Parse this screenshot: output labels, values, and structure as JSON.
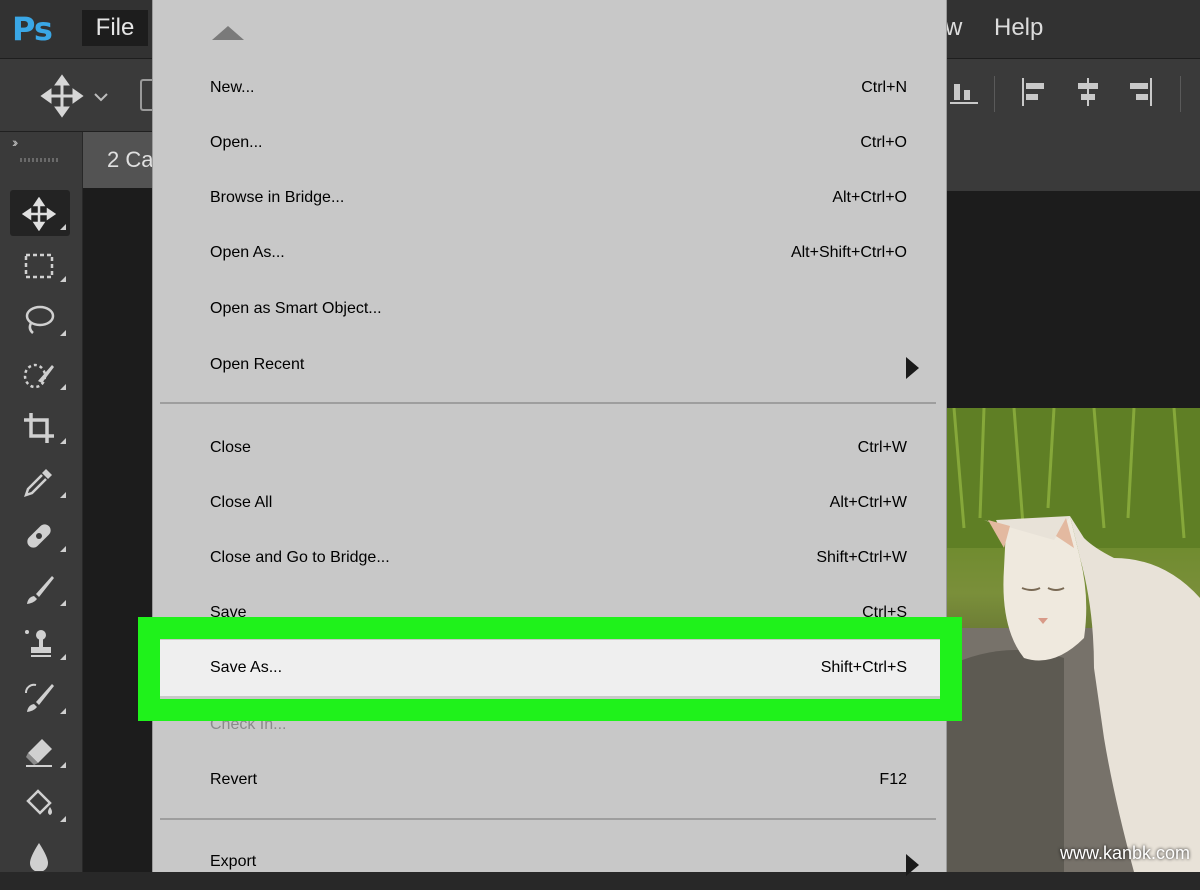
{
  "app": {
    "logo": "Ps",
    "menubar": {
      "file": "File",
      "partial": "w",
      "help": "Help"
    },
    "document_tab": "2 Ca",
    "watermark": "www.kanbk.com"
  },
  "file_menu": {
    "group1": [
      {
        "label": "New...",
        "shortcut": "Ctrl+N"
      },
      {
        "label": "Open...",
        "shortcut": "Ctrl+O"
      },
      {
        "label": "Browse in Bridge...",
        "shortcut": "Alt+Ctrl+O"
      },
      {
        "label": "Open As...",
        "shortcut": "Alt+Shift+Ctrl+O"
      },
      {
        "label": "Open as Smart Object...",
        "shortcut": ""
      },
      {
        "label": "Open Recent",
        "shortcut": "",
        "submenu": true
      }
    ],
    "group2": [
      {
        "label": "Close",
        "shortcut": "Ctrl+W"
      },
      {
        "label": "Close All",
        "shortcut": "Alt+Ctrl+W"
      },
      {
        "label": "Close and Go to Bridge...",
        "shortcut": "Shift+Ctrl+W"
      },
      {
        "label": "Save",
        "shortcut": "Ctrl+S"
      },
      {
        "label": "Save As...",
        "shortcut": "Shift+Ctrl+S",
        "highlighted": true
      },
      {
        "label": "Check In...",
        "shortcut": "",
        "disabled": true
      },
      {
        "label": "Revert",
        "shortcut": "F12"
      }
    ],
    "group3": [
      {
        "label": "Export",
        "shortcut": "",
        "submenu": true
      }
    ]
  },
  "colors": {
    "highlight_outline": "#1ff21b",
    "menu_bg": "#c8c8c8",
    "ps_blue": "#3aa7e6"
  },
  "toolbar_tools": [
    "move-tool",
    "marquee-tool",
    "lasso-tool",
    "quick-selection-tool",
    "crop-tool",
    "eyedropper-tool",
    "healing-brush-tool",
    "brush-tool",
    "clone-stamp-tool",
    "history-brush-tool",
    "eraser-tool",
    "paint-bucket-tool",
    "blur-tool"
  ]
}
